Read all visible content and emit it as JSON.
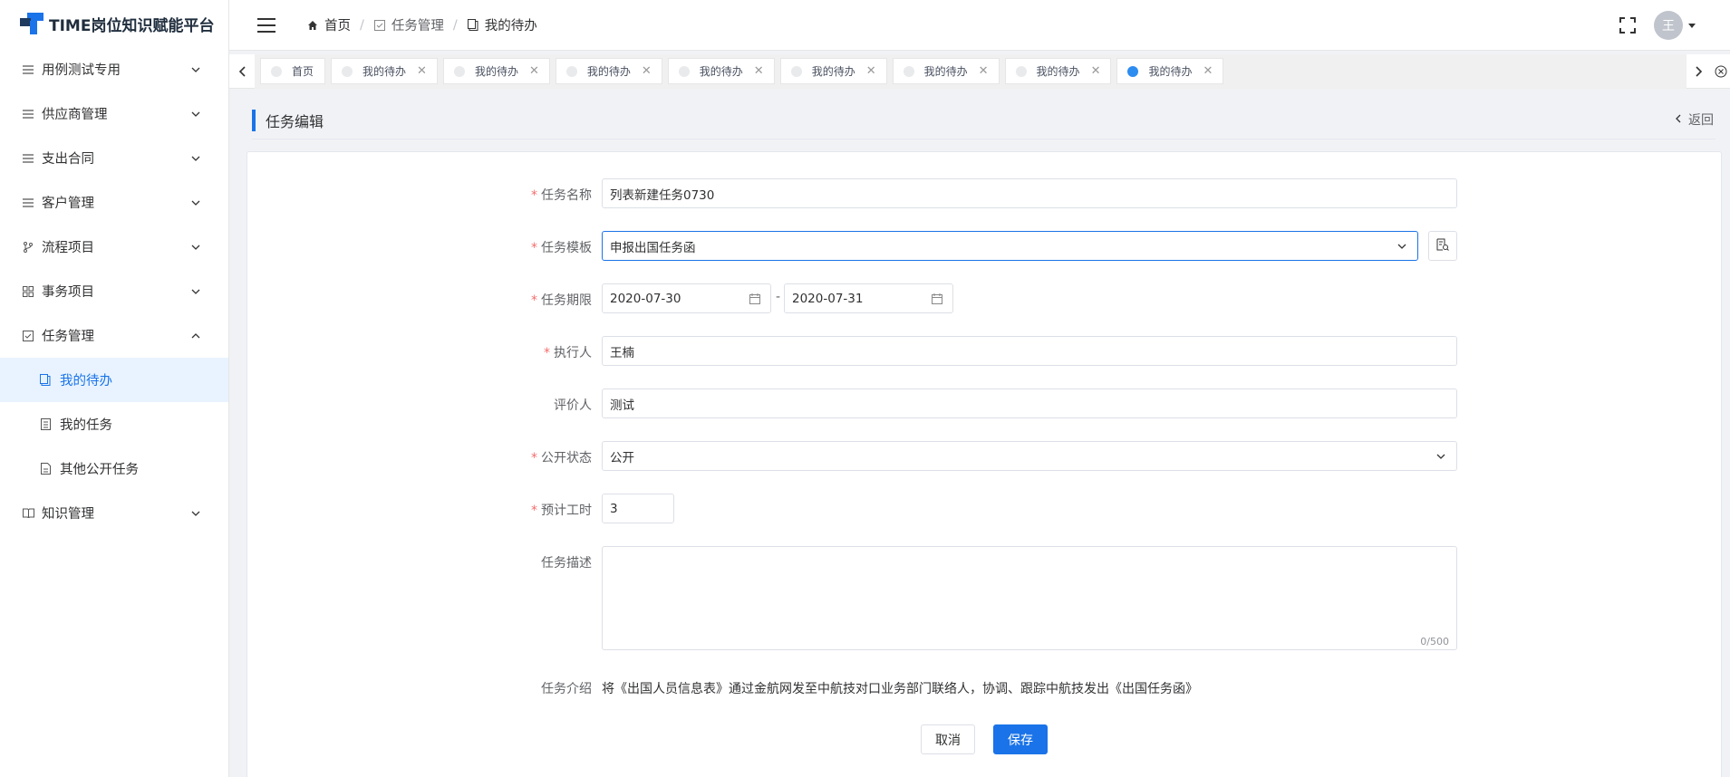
{
  "app": {
    "title": "TIME岗位知识赋能平台"
  },
  "sidebar": {
    "items": [
      {
        "label": "用例测试专用",
        "icon": "list-icon"
      },
      {
        "label": "供应商管理",
        "icon": "list-icon"
      },
      {
        "label": "支出合同",
        "icon": "list-icon"
      },
      {
        "label": "客户管理",
        "icon": "list-icon"
      },
      {
        "label": "流程项目",
        "icon": "branch-icon"
      },
      {
        "label": "事务项目",
        "icon": "grid-icon"
      },
      {
        "label": "任务管理",
        "icon": "checkbox-icon",
        "expanded": true
      }
    ],
    "subitems": [
      {
        "label": "我的待办",
        "icon": "clipboard-icon",
        "active": true
      },
      {
        "label": "我的任务",
        "icon": "doc-list-icon"
      },
      {
        "label": "其他公开任务",
        "icon": "doc-icon"
      }
    ],
    "last_item": {
      "label": "知识管理",
      "icon": "book-icon"
    }
  },
  "header": {
    "breadcrumb": [
      {
        "label": "首页",
        "icon": "home-icon"
      },
      {
        "label": "任务管理",
        "icon": "checkbox-icon"
      },
      {
        "label": "我的待办",
        "icon": "clipboard-icon"
      }
    ],
    "avatar_text": "王"
  },
  "tabs": [
    {
      "label": "首页",
      "closable": false
    },
    {
      "label": "我的待办",
      "closable": true
    },
    {
      "label": "我的待办",
      "closable": true
    },
    {
      "label": "我的待办",
      "closable": true
    },
    {
      "label": "我的待办",
      "closable": true
    },
    {
      "label": "我的待办",
      "closable": true
    },
    {
      "label": "我的待办",
      "closable": true
    },
    {
      "label": "我的待办",
      "closable": true
    },
    {
      "label": "我的待办",
      "closable": true,
      "active": true
    }
  ],
  "page": {
    "title": "任务编辑",
    "back_label": "返回"
  },
  "form": {
    "task_name": {
      "label": "任务名称",
      "value": "列表新建任务0730",
      "required": true
    },
    "template": {
      "label": "任务模板",
      "value": "申报出国任务函",
      "required": true
    },
    "deadline": {
      "label": "任务期限",
      "start": "2020-07-30",
      "end": "2020-07-31",
      "separator": "-",
      "required": true
    },
    "executor": {
      "label": "执行人",
      "value": "王楠",
      "required": true
    },
    "reviewer": {
      "label": "评价人",
      "value": "测试",
      "required": false
    },
    "visibility": {
      "label": "公开状态",
      "value": "公开",
      "required": true
    },
    "hours": {
      "label": "预计工时",
      "value": "3",
      "required": true
    },
    "description": {
      "label": "任务描述",
      "value": "",
      "counter": "0/500"
    },
    "intro": {
      "label": "任务介绍",
      "text": "将《出国人员信息表》通过金航网发至中航技对口业务部门联络人，协调、跟踪中航技发出《出国任务函》"
    },
    "cancel_label": "取消",
    "save_label": "保存"
  },
  "colors": {
    "accent": "#1a73e8",
    "required": "#f56c6c",
    "active_bg": "#e8f3ff"
  }
}
